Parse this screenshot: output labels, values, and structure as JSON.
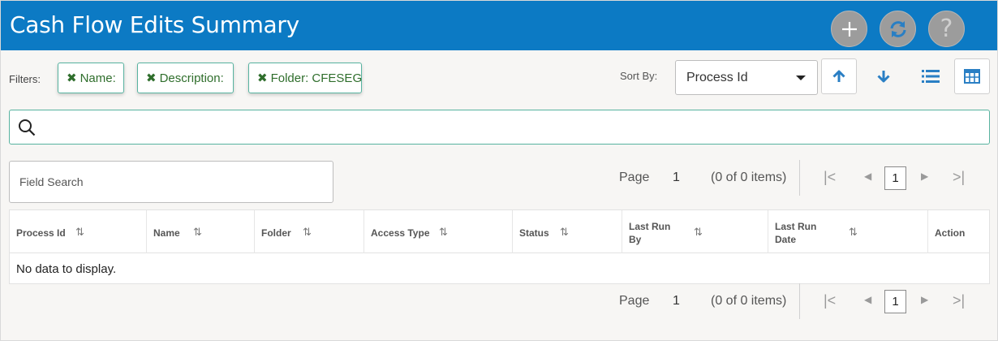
{
  "header": {
    "title": "Cash Flow Edits Summary",
    "add_icon": "plus-icon",
    "refresh_icon": "refresh-icon",
    "help_label": "?"
  },
  "filters": {
    "label": "Filters:",
    "chips": [
      {
        "label": "Name:"
      },
      {
        "label": "Description:"
      },
      {
        "label": "Folder: CFESEG"
      }
    ],
    "remove_icon": "✖"
  },
  "sort": {
    "label": "Sort By:",
    "selected": "Process Id"
  },
  "search": {
    "value": "",
    "placeholder": ""
  },
  "field_search": {
    "placeholder": "Field Search"
  },
  "pager": {
    "page_label": "Page",
    "page_number": "1",
    "items_text": "(0 of 0 items)",
    "current_page": "1"
  },
  "table": {
    "columns": [
      {
        "label": "Process Id"
      },
      {
        "label": "Name"
      },
      {
        "label": "Folder"
      },
      {
        "label": "Access Type"
      },
      {
        "label": "Status"
      },
      {
        "label": "Last Run By"
      },
      {
        "label": "Last Run Date"
      },
      {
        "label": "Action"
      }
    ],
    "empty_message": "No data to display."
  },
  "colors": {
    "header_bg": "#0c7ac4",
    "chip_border": "#58b3a0",
    "chip_text": "#2f6e2c",
    "icon_blue": "#2a7fc4"
  }
}
